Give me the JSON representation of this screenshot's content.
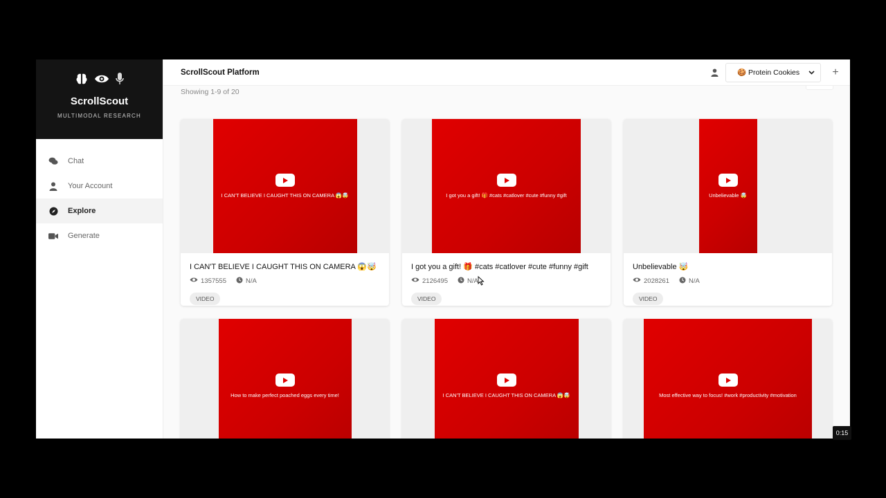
{
  "brand": {
    "title": "ScrollScout",
    "subtitle": "MULTIMODAL RESEARCH"
  },
  "sidebar": {
    "items": [
      {
        "label": "Chat",
        "icon": "comments-icon",
        "active": false
      },
      {
        "label": "Your Account",
        "icon": "user-icon",
        "active": false
      },
      {
        "label": "Explore",
        "icon": "compass-icon",
        "active": true
      },
      {
        "label": "Generate",
        "icon": "video-camera-icon",
        "active": false
      }
    ]
  },
  "topbar": {
    "title": "ScrollScout Platform",
    "project_select": {
      "value": "🍪 Protein Cookies"
    },
    "add_label": "+"
  },
  "main": {
    "showing": "Showing 1-9 of 20"
  },
  "cards": [
    {
      "thumb_text": "I CAN'T BELIEVE I CAUGHT THIS ON CAMERA 😱🤯",
      "title": "I CAN'T BELIEVE I CAUGHT THIS ON CAMERA 😱🤯",
      "views": "1357555",
      "duration": "N/A",
      "tag": "VIDEO"
    },
    {
      "thumb_text": "I got you a gift! 🎁 #cats #catlover #cute #funny #gift",
      "title": "I got you a gift! 🎁 #cats #catlover #cute #funny #gift",
      "views": "2126495",
      "duration": "N/A",
      "tag": "VIDEO"
    },
    {
      "thumb_text": "Unbelievable 🤯",
      "title": "Unbelievable 🤯",
      "views": "2028261",
      "duration": "N/A",
      "tag": "VIDEO"
    },
    {
      "thumb_text": "How to make perfect poached eggs every time!"
    },
    {
      "thumb_text": "I CAN'T BELIEVE I CAUGHT THIS ON CAMERA 😱🤯"
    },
    {
      "thumb_text": "Most effective way to focus! #work #productivity #motivation"
    }
  ],
  "video_timer": "0:15"
}
